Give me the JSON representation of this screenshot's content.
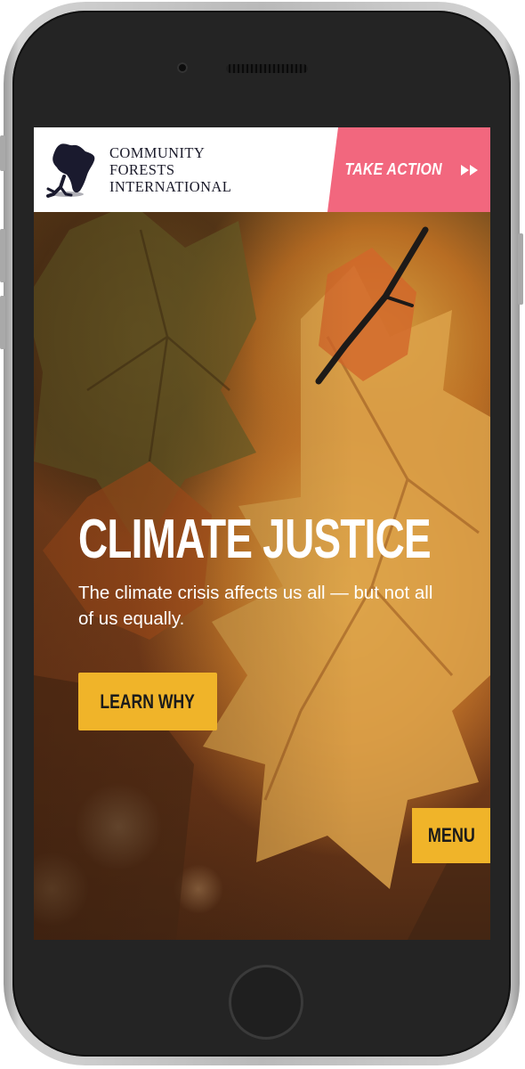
{
  "header": {
    "logo": {
      "icon": "africa-map-tree-icon",
      "lines": [
        "COMMUNITY",
        "FORESTS",
        "INTERNATIONAL"
      ]
    },
    "take_action": {
      "label": "TAKE ACTION",
      "icon": "fast-forward-icon",
      "color": "#f2677e"
    }
  },
  "hero": {
    "title": "CLIMATE JUSTICE",
    "subtitle": "The climate crisis affects us all — but not all of us equally.",
    "cta_label": "LEARN WHY",
    "accent_color": "#f0b429"
  },
  "menu": {
    "label": "MENU"
  }
}
